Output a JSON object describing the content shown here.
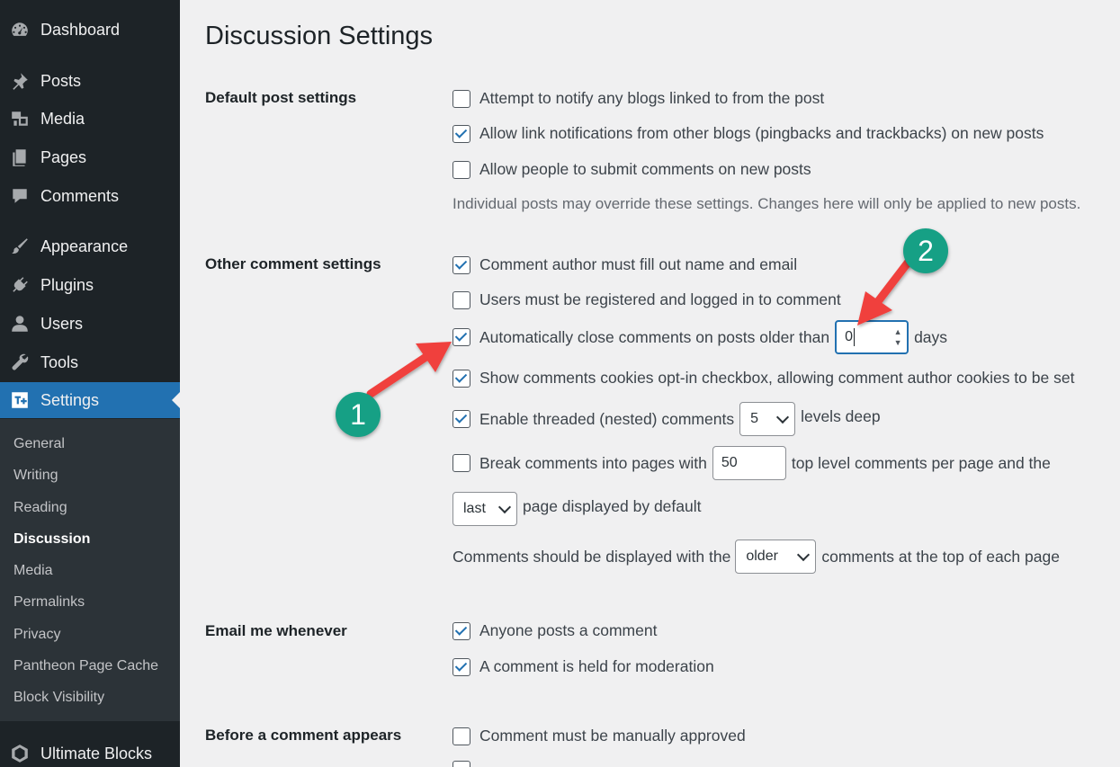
{
  "sidebar": {
    "items": [
      {
        "label": "Dashboard",
        "icon": "dashboard-icon"
      },
      {
        "label": "Posts",
        "icon": "pin-icon"
      },
      {
        "label": "Media",
        "icon": "media-icon"
      },
      {
        "label": "Pages",
        "icon": "pages-icon"
      },
      {
        "label": "Comments",
        "icon": "comment-icon"
      },
      {
        "label": "Appearance",
        "icon": "brush-icon"
      },
      {
        "label": "Plugins",
        "icon": "plug-icon"
      },
      {
        "label": "Users",
        "icon": "user-icon"
      },
      {
        "label": "Tools",
        "icon": "wrench-icon"
      },
      {
        "label": "Settings",
        "icon": "settings-icon"
      },
      {
        "label": "Ultimate Blocks",
        "icon": "blocks-icon"
      }
    ],
    "submenu": [
      "General",
      "Writing",
      "Reading",
      "Discussion",
      "Media",
      "Permalinks",
      "Privacy",
      "Pantheon Page Cache",
      "Block Visibility"
    ],
    "current_submenu": "Discussion",
    "active_color": "#2271b1"
  },
  "page": {
    "title": "Discussion Settings"
  },
  "default_post": {
    "label": "Default post settings",
    "options": [
      {
        "label": "Attempt to notify any blogs linked to from the post",
        "checked": false
      },
      {
        "label": "Allow link notifications from other blogs (pingbacks and trackbacks) on new posts",
        "checked": true
      },
      {
        "label": "Allow people to submit comments on new posts",
        "checked": false
      }
    ],
    "description": "Individual posts may override these settings. Changes here will only be applied to new posts."
  },
  "other_comment": {
    "label": "Other comment settings",
    "require_name": {
      "label": "Comment author must fill out name and email",
      "checked": true
    },
    "registration": {
      "label": "Users must be registered and logged in to comment",
      "checked": false
    },
    "auto_close": {
      "label": "Automatically close comments on posts older than",
      "checked": true,
      "value": "0",
      "suffix": "days"
    },
    "cookies": {
      "label": "Show comments cookies opt-in checkbox, allowing comment author cookies to be set",
      "checked": true
    },
    "threaded": {
      "label": "Enable threaded (nested) comments",
      "checked": true,
      "value": "5",
      "suffix": "levels deep"
    },
    "paged": {
      "label": "Break comments into pages with",
      "checked": false,
      "value": "50",
      "suffix": "top level comments per page and the"
    },
    "default_page": {
      "value": "last",
      "suffix": "page displayed by default"
    },
    "order": {
      "prefix": "Comments should be displayed with the",
      "value": "older",
      "suffix": "comments at the top of each page"
    }
  },
  "email": {
    "label": "Email me whenever",
    "options": [
      {
        "label": "Anyone posts a comment",
        "checked": true
      },
      {
        "label": "A comment is held for moderation",
        "checked": true
      }
    ]
  },
  "before_appears": {
    "label": "Before a comment appears",
    "options": [
      {
        "label": "Comment must be manually approved",
        "checked": false
      }
    ]
  },
  "annotations": {
    "badge1": "1",
    "badge2": "2",
    "badge_color": "#16a085",
    "arrow_color": "#f0413d"
  }
}
